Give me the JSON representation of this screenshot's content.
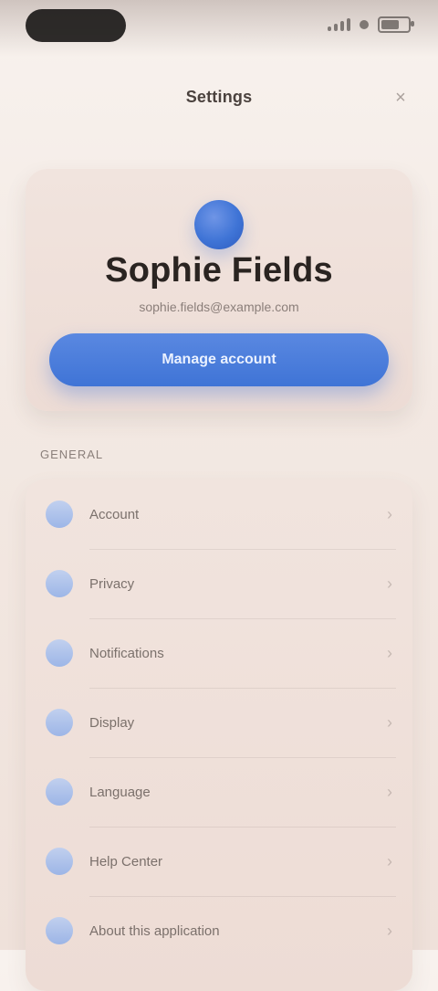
{
  "header": {
    "title": "Settings",
    "action_icon": "close-icon"
  },
  "profile": {
    "name": "Sophie Fields",
    "subtitle": "sophie.fields@example.com",
    "primary_button_label": "Manage account"
  },
  "sections": {
    "general_label": "General"
  },
  "list": {
    "items": [
      {
        "label": "Account",
        "icon": "user-icon"
      },
      {
        "label": "Privacy",
        "icon": "lock-icon"
      },
      {
        "label": "Notifications",
        "icon": "bell-icon"
      },
      {
        "label": "Display",
        "icon": "sun-icon"
      },
      {
        "label": "Language",
        "icon": "globe-icon"
      },
      {
        "label": "Help Center",
        "icon": "help-icon"
      },
      {
        "label": "About this application",
        "icon": "info-icon"
      }
    ]
  },
  "colors": {
    "accent": "#3f74d6",
    "background": "#f6efe9",
    "card": "#eddcd5"
  }
}
